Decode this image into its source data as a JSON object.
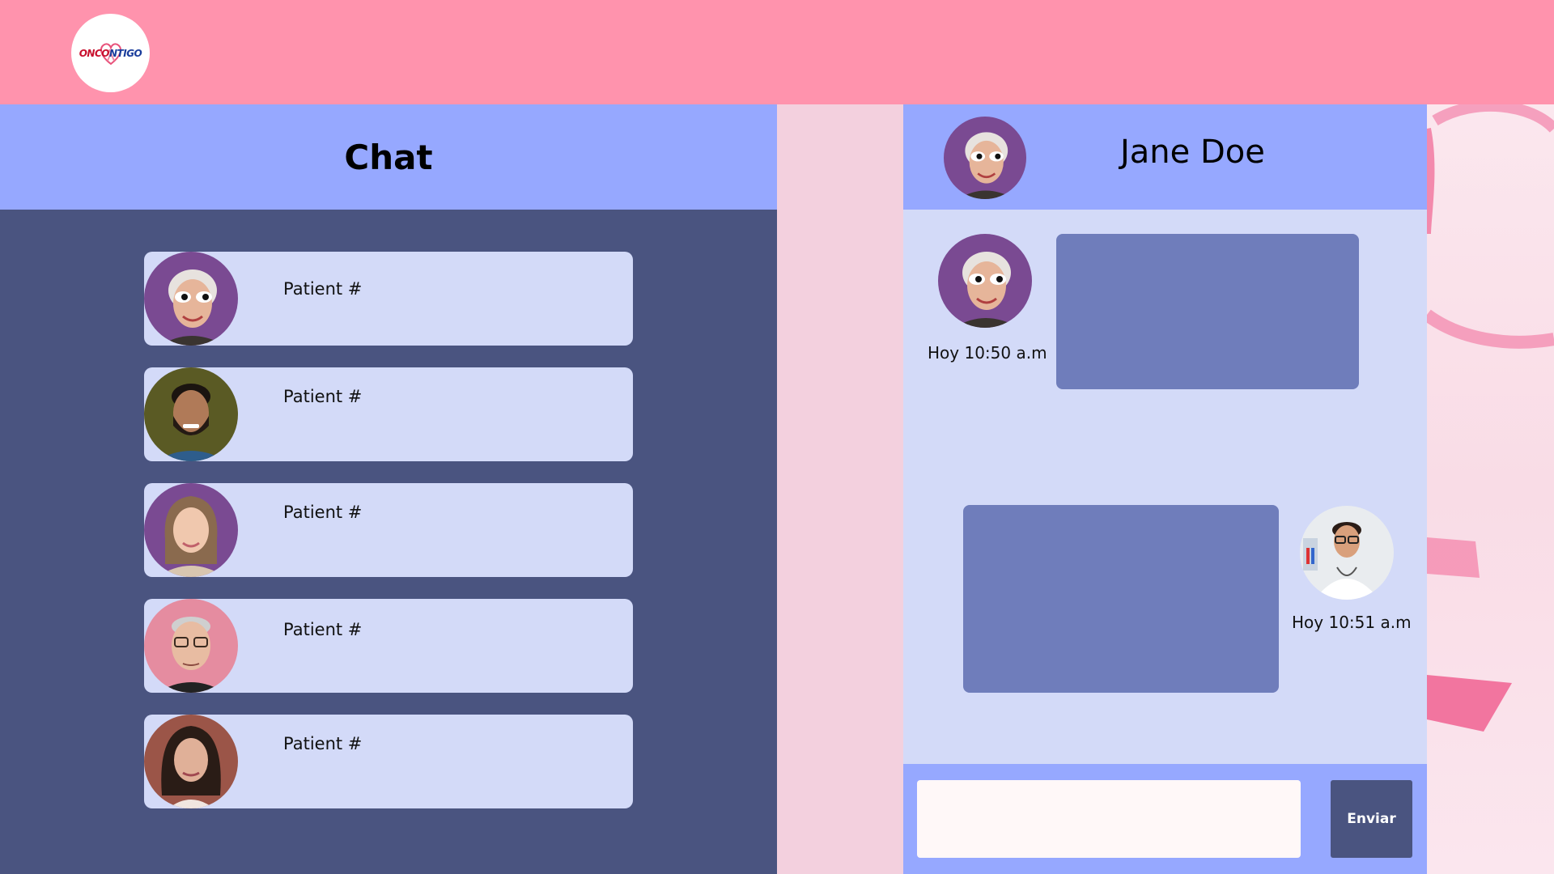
{
  "header": {
    "logo": {
      "text_red_start": "ONC",
      "text_red_mid": "O",
      "text_blue": "NTIGO",
      "icon": "heart-ribbon-icon"
    }
  },
  "chat_list": {
    "title": "Chat",
    "patients": [
      {
        "label": "Patient #",
        "avatar": "avatar-elderly-woman-sunglasses",
        "avatar_bg": "#7a4a92"
      },
      {
        "label": "Patient #",
        "avatar": "avatar-young-man-beard",
        "avatar_bg": "#5a5a24"
      },
      {
        "label": "Patient #",
        "avatar": "avatar-young-woman",
        "avatar_bg": "#7a4a92"
      },
      {
        "label": "Patient #",
        "avatar": "avatar-older-man-glasses",
        "avatar_bg": "#e58ca0"
      },
      {
        "label": "Patient #",
        "avatar": "avatar-woman-dark-hair",
        "avatar_bg": "#9b5548"
      }
    ]
  },
  "conversation": {
    "contact_name": "Jane Doe",
    "messages": [
      {
        "from": "patient",
        "time": "Hoy 10:50 a.m",
        "avatar": "avatar-elderly-woman-sunglasses"
      },
      {
        "from": "doctor",
        "time": "Hoy 10:51 a.m",
        "avatar": "avatar-doctor"
      }
    ],
    "composer": {
      "placeholder": "",
      "send_label": "Enviar"
    }
  },
  "colors": {
    "topbar": "#ff93ad",
    "panel_header": "#96a8ff",
    "list_bg": "#4a5480",
    "card_bg": "#d3daf8",
    "bubble": "#6f7dbb",
    "send_button": "#4a5480"
  }
}
